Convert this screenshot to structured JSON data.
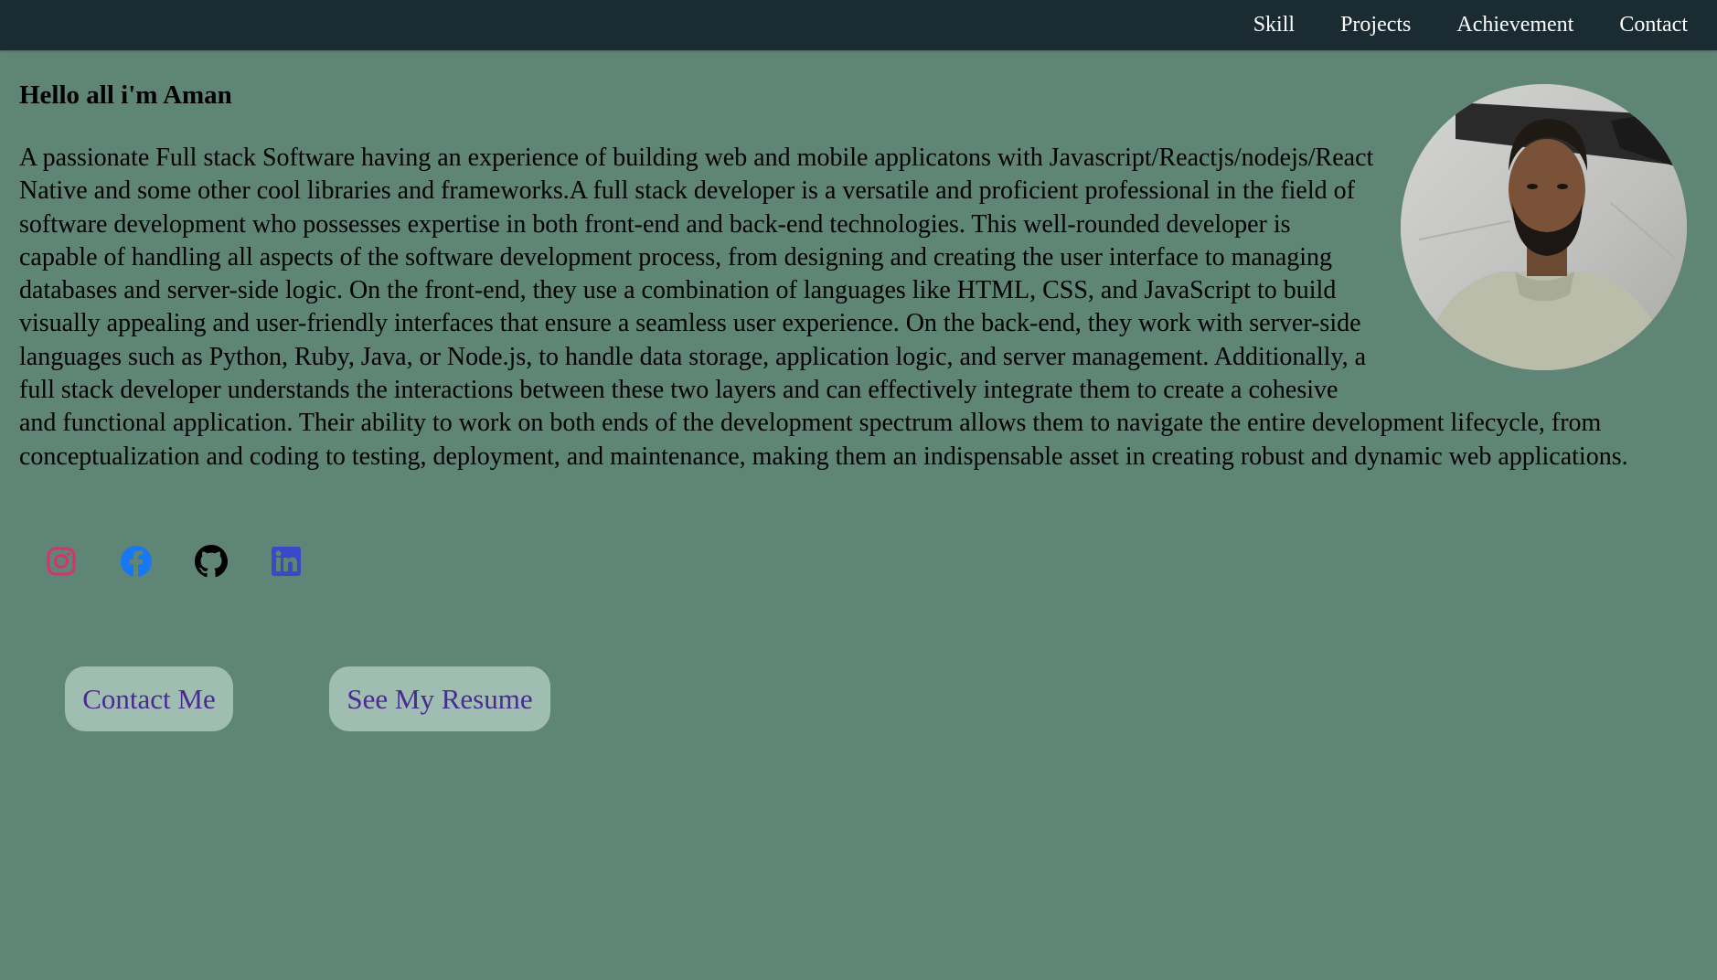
{
  "nav": {
    "items": [
      {
        "label": "Skill"
      },
      {
        "label": "Projects"
      },
      {
        "label": "Achievement"
      },
      {
        "label": "Contact"
      }
    ]
  },
  "hero": {
    "greeting": "Hello all i'm Aman",
    "bio": "A passionate Full stack Software having an experience of building web and mobile applicatons with Javascript/Reactjs/nodejs/React Native and some other cool libraries and frameworks.A full stack developer is a versatile and proficient professional in the field of software development who possesses expertise in both front-end and back-end technologies. This well-rounded developer is capable of handling all aspects of the software development process, from designing and creating the user interface to managing databases and server-side logic. On the front-end, they use a combination of languages like HTML, CSS, and JavaScript to build visually appealing and user-friendly interfaces that ensure a seamless user experience. On the back-end, they work with server-side languages such as Python, Ruby, Java, or Node.js, to handle data storage, application logic, and server management. Additionally, a full stack developer understands the interactions between these two layers and can effectively integrate them to create a cohesive and functional application. Their ability to work on both ends of the development spectrum allows them to navigate the entire development lifecycle, from conceptualization and coding to testing, deployment, and maintenance, making them an indispensable asset in creating robust and dynamic web applications."
  },
  "social": [
    {
      "icon": "instagram-icon",
      "color": "#d6336c"
    },
    {
      "icon": "facebook-icon",
      "color": "#1877f2"
    },
    {
      "icon": "github-icon",
      "color": "#000000"
    },
    {
      "icon": "linkedin-icon",
      "color": "#3949c9"
    }
  ],
  "actions": {
    "contact_label": "Contact Me",
    "resume_label": "See My Resume"
  },
  "colors": {
    "background": "#5e8575",
    "navbar": "#1a2b31",
    "button_bg": "#a0bdb2",
    "button_text": "#4a2a93"
  }
}
